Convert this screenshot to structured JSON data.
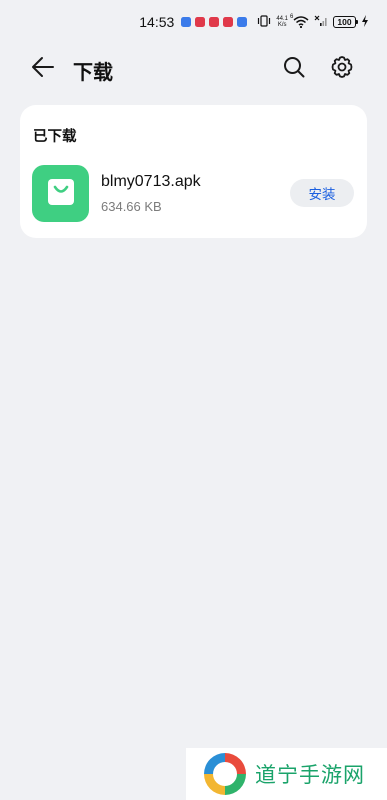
{
  "status_bar": {
    "time": "14:53",
    "notification_colors": [
      "#3b7bea",
      "#e0394a",
      "#e0394a",
      "#e0394a",
      "#3b7bea"
    ],
    "net_speed_value": "44.1",
    "net_speed_unit": "K/s",
    "wifi_label": "6",
    "battery": "100"
  },
  "header": {
    "title": "下载",
    "back_icon": "arrow-left-icon",
    "search_icon": "search-icon",
    "settings_icon": "gear-icon"
  },
  "downloads": {
    "section_title": "已下载",
    "items": [
      {
        "name": "blmy0713.apk",
        "size": "634.66 KB",
        "action_label": "安装",
        "icon": "shopping-bag-icon",
        "icon_color": "#3fcf82"
      }
    ]
  },
  "watermark": {
    "text": "道宁手游网"
  },
  "colors": {
    "background": "#f0f1f4",
    "card": "#ffffff",
    "accent": "#1b5fe0",
    "app_icon": "#3fcf82"
  }
}
